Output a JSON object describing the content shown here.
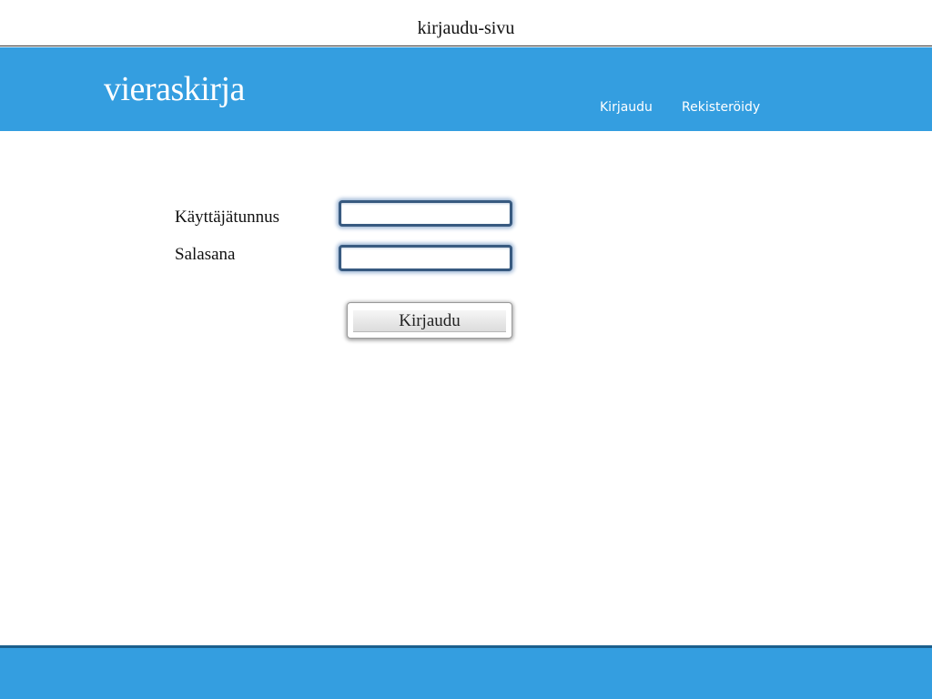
{
  "page": {
    "heading": "kirjaudu-sivu"
  },
  "header": {
    "logo": "vieraskirja",
    "nav": {
      "login": "Kirjaudu",
      "register": "Rekisteröidy"
    },
    "background_color": "#349ee0"
  },
  "login_form": {
    "username_label": "Käyttäjätunnus",
    "username_value": "",
    "password_label": "Salasana",
    "password_value": "",
    "submit_label": "Kirjaudu"
  },
  "footer": {
    "background_color": "#349ee0",
    "border_color": "#1b5f8c"
  }
}
